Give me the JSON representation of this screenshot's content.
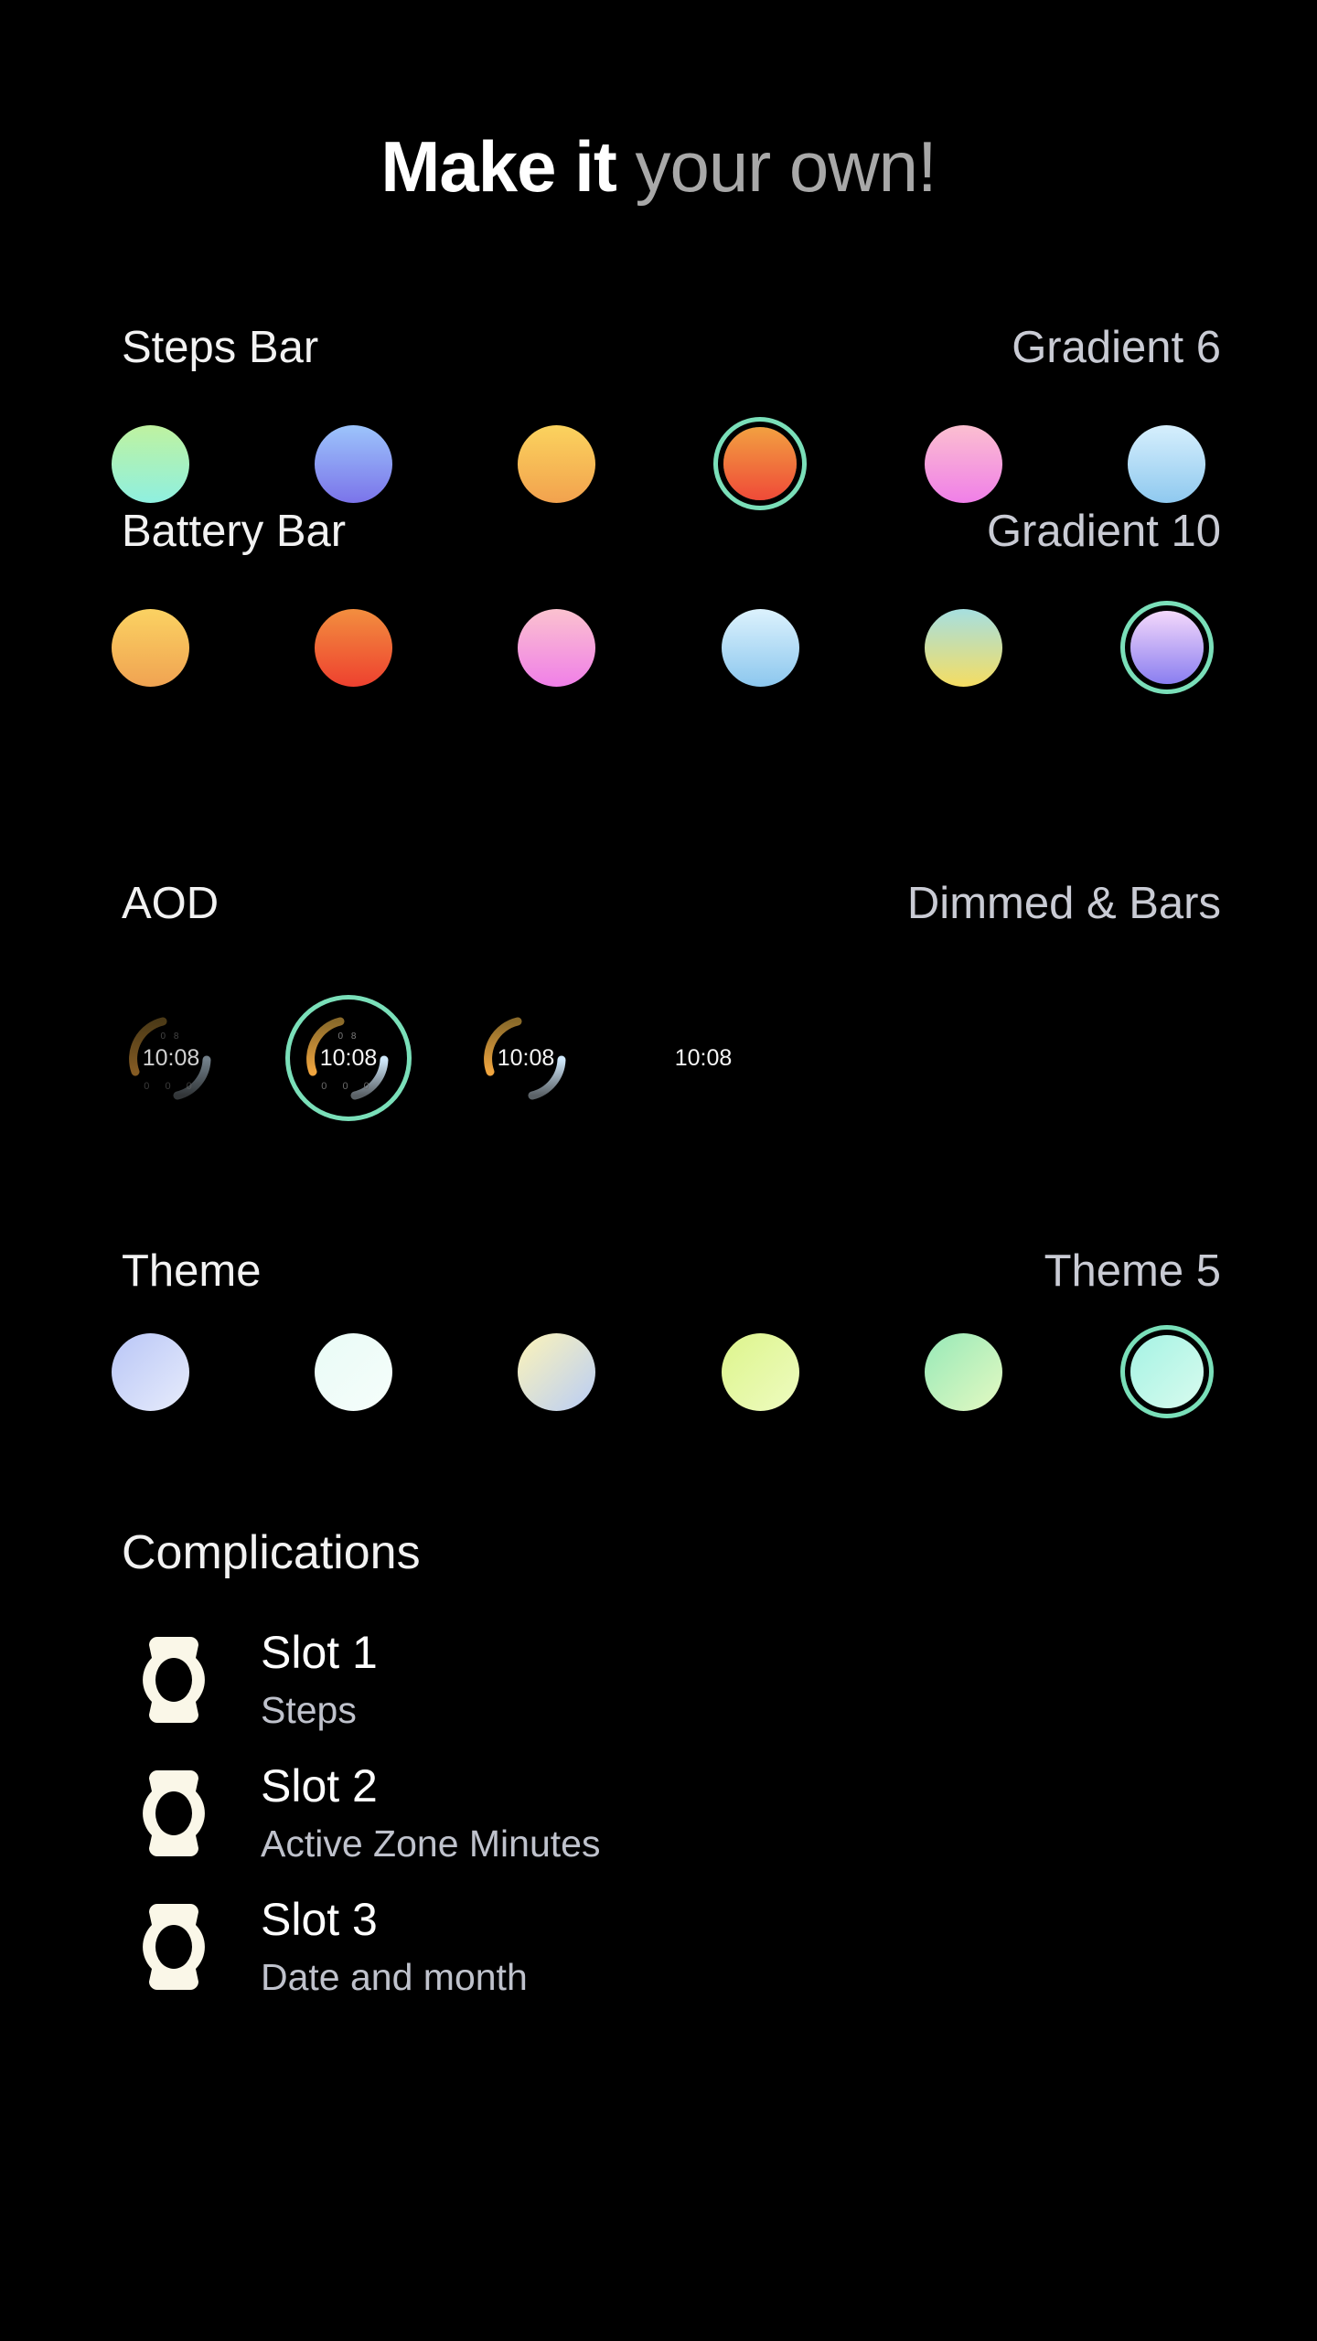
{
  "title": {
    "strong": "Make it ",
    "soft": "your own!"
  },
  "colors": {
    "background": "#000000",
    "selection_ring": "#7adfb9",
    "label": "#f2f2f2",
    "value_label": "#c9cbd4",
    "subtitle": "#bfc2cc",
    "watch_icon": "#faf7e8"
  },
  "sections": [
    {
      "id": "steps-bar",
      "label": "Steps Bar",
      "value": "Gradient 6",
      "selected_index": 3,
      "swatches": [
        {
          "name": "gradient-1",
          "from": "#bff2a0",
          "to": "#8ff0e0"
        },
        {
          "name": "gradient-2",
          "from": "#9cc4fb",
          "to": "#7b74ea"
        },
        {
          "name": "gradient-3",
          "from": "#fbd35e",
          "to": "#f2a24e"
        },
        {
          "name": "gradient-4",
          "from": "#f2a041",
          "to": "#ef4a38"
        },
        {
          "name": "gradient-5",
          "from": "#fbbfd0",
          "to": "#f07fe8"
        },
        {
          "name": "gradient-6",
          "from": "#d6effd",
          "to": "#8fc9ef"
        }
      ]
    },
    {
      "id": "battery-bar",
      "label": "Battery Bar",
      "value": "Gradient 10",
      "selected_index": 5,
      "swatches": [
        {
          "name": "gradient-1",
          "from": "#fbd262",
          "to": "#f0a352"
        },
        {
          "name": "gradient-2",
          "from": "#f28e3f",
          "to": "#ee412f"
        },
        {
          "name": "gradient-3",
          "from": "#fbc2cf",
          "to": "#f07fe8"
        },
        {
          "name": "gradient-4",
          "from": "#dcf2fd",
          "to": "#8cc7ee"
        },
        {
          "name": "gradient-5",
          "from": "#a6dfe0",
          "to": "#f5dd62"
        },
        {
          "name": "gradient-6",
          "from": "#f4d8fb",
          "to": "#8a7ef0"
        }
      ]
    },
    {
      "id": "aod",
      "label": "AOD",
      "value": "Dimmed & Bars",
      "selected_index": 1,
      "previews": [
        {
          "name": "aod-dimmed-bars-dots",
          "time": "10:08",
          "bars": true,
          "dots": true,
          "mini": true,
          "dim": 0.55
        },
        {
          "name": "aod-dimmed-bars-selected",
          "time": "10:08",
          "bars": true,
          "dots": true,
          "mini": true,
          "dim": 1
        },
        {
          "name": "aod-bars-only",
          "time": "10:08",
          "bars": true,
          "dots": false,
          "mini": false,
          "dim": 1
        },
        {
          "name": "aod-time-only",
          "time": "10:08",
          "bars": false,
          "dots": false,
          "mini": false,
          "dim": 1
        }
      ]
    },
    {
      "id": "theme",
      "label": "Theme",
      "value": "Theme 5",
      "selected_index": 5,
      "swatches": [
        {
          "name": "theme-1",
          "from": "#b9c6f7",
          "to": "#e7ecfb"
        },
        {
          "name": "theme-2",
          "from": "#e9fbf6",
          "to": "#f6fefb"
        },
        {
          "name": "theme-3",
          "from": "#fdf4b8",
          "to": "#b9cdf6"
        },
        {
          "name": "theme-4",
          "from": "#ddf58c",
          "to": "#eefbc0"
        },
        {
          "name": "theme-5",
          "from": "#97e9b8",
          "to": "#e4f9c2"
        },
        {
          "name": "theme-6",
          "from": "#a5f3e4",
          "to": "#d8fbee"
        }
      ]
    }
  ],
  "complications": {
    "title": "Complications",
    "items": [
      {
        "slot": "Slot 1",
        "value": "Steps"
      },
      {
        "slot": "Slot 2",
        "value": "Active Zone Minutes"
      },
      {
        "slot": "Slot 3",
        "value": "Date and month"
      }
    ]
  }
}
